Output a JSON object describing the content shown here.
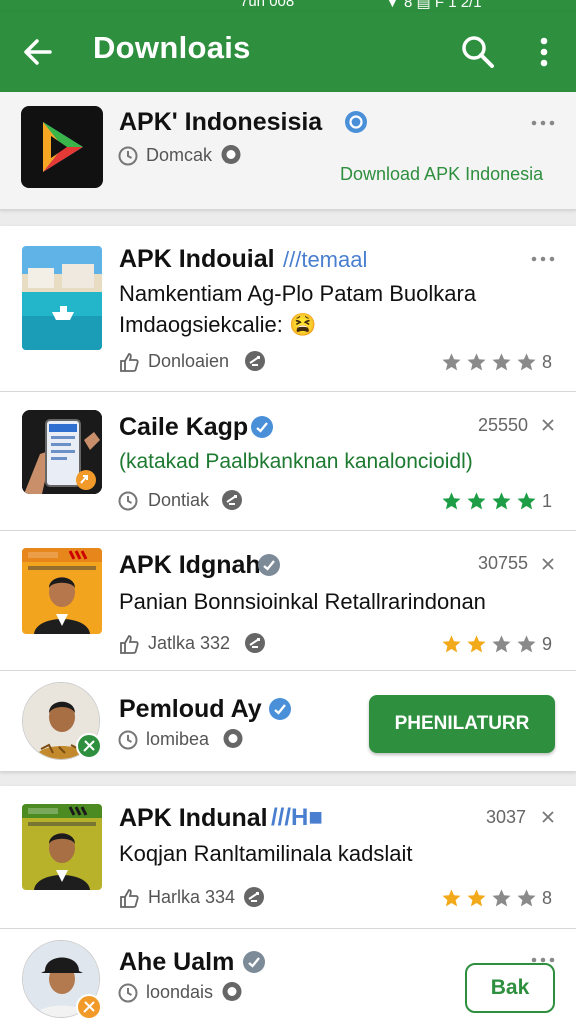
{
  "status_bar": {
    "left_text": "7uh 008",
    "right_text": "▼ 8 ▤ F 1 2/1"
  },
  "app_bar": {
    "title": "Downloais"
  },
  "colors": {
    "primary": "#2e8f3e",
    "star_gray": "#8a8a8a",
    "star_gold": "#f2a91a",
    "star_green": "#1d9e46",
    "badge_blue": "#4a90d9"
  },
  "icons": [
    "back-arrow-icon",
    "search-icon",
    "more-vert-icon",
    "verified-badge-icon",
    "clock-icon",
    "chat-icon",
    "share-icon",
    "download-icon",
    "close-icon",
    "star-icon"
  ],
  "items": [
    {
      "name": "APK' Indonesisia",
      "meta_text": "Domcak",
      "link_text": "Download APK Indonesia"
    },
    {
      "name": "APK Indouial",
      "name_suffix": "///temaal",
      "subtitle": "Namkentiam Ag-Plo Patam Buolkara Imdaogsiekcalie: 😫",
      "subtitle_line1": "Namkentiam Ag-Plo Patam Buolkara",
      "subtitle_line2": "Imdaogsiekcalie: 😫",
      "meta_text": "Donloaien",
      "rating": {
        "filled": 0,
        "total": 4,
        "color": "gray"
      },
      "rating_count": "8"
    },
    {
      "name": "Caile Kagp",
      "count": "25550",
      "subtitle": "(katakad Paalbkanknan kanaloncioidl)",
      "meta_text": "Dontiak",
      "rating": {
        "filled": 4,
        "total": 4,
        "color": "green"
      },
      "rating_count": "1"
    },
    {
      "name": "APK Idgnah",
      "count": "30755",
      "subtitle": "Panian Bonnsioinkal Retallrarindonan",
      "meta_text": "Jatlka 332",
      "rating": {
        "filled": 2,
        "total": 4,
        "color": "gold"
      },
      "rating_count": "9"
    },
    {
      "name": "Pemloud Ay",
      "meta_text": "lomibea",
      "button_label": "PHENILATURR"
    },
    {
      "name": "APK Indunal",
      "name_suffix": "///H■",
      "count": "3037",
      "subtitle": "Koqjan Ranltamilinala kadslait",
      "meta_text": "Harlka 334",
      "rating": {
        "filled": 2,
        "total": 4,
        "color": "gold"
      },
      "rating_count": "8"
    },
    {
      "name": "Ahe Ualm",
      "meta_text": "loondais",
      "button_label": "Bak"
    }
  ]
}
